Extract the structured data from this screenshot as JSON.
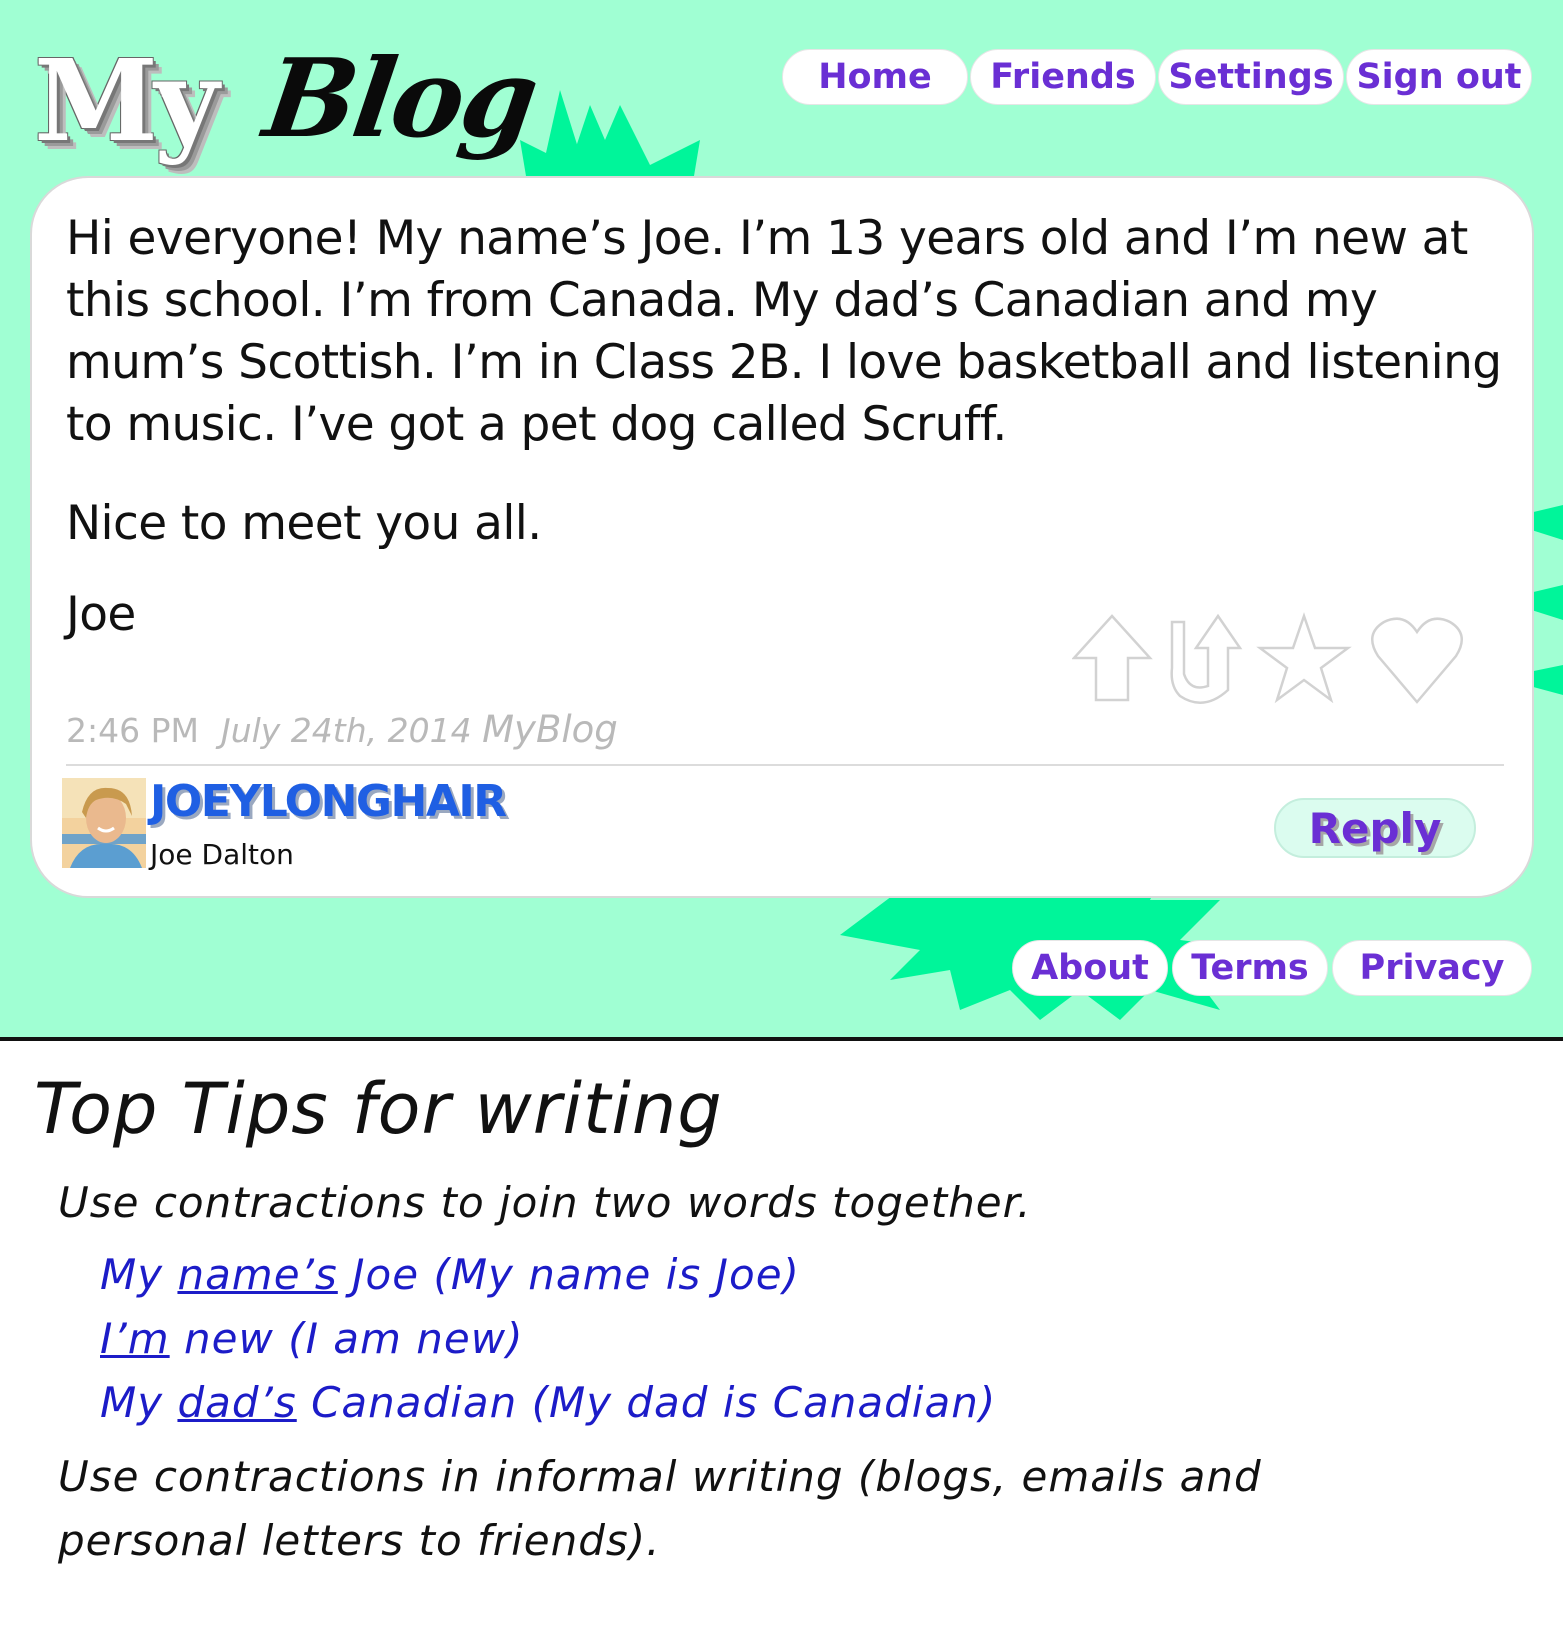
{
  "logo": {
    "part1": "My",
    "part2": "Blog"
  },
  "nav": {
    "home": "Home",
    "friends": "Friends",
    "settings": "Settings",
    "sign_out": "Sign out"
  },
  "post": {
    "body": "Hi everyone! My name’s Joe. I’m 13 years old and I’m new at this school. I’m from Canada. My dad’s Canadian and my mum’s Scottish. I’m in Class 2B. I love basketball and listening to music. I’ve got a pet dog called Scruff.",
    "closing": "Nice to meet you all.",
    "signature": "Joe",
    "time": "2:46 PM",
    "date": "July 24th, 2014",
    "site": "MyBlog",
    "author_username": "JOEYLONGHAIR",
    "author_name": "Joe Dalton",
    "reply_label": "Reply",
    "reaction_icons": [
      "up-arrow-icon",
      "u-turn-arrow-icon",
      "star-icon",
      "heart-icon"
    ]
  },
  "footer_nav": {
    "about": "About",
    "terms": "Terms",
    "privacy": "Privacy"
  },
  "tips": {
    "title": "Top Tips for writing",
    "line1": "Use contractions to join two words together.",
    "examples": [
      {
        "pre": "My ",
        "contraction": "name’s",
        "post": " Joe",
        "expanded": " (My name is Joe)"
      },
      {
        "pre": "",
        "contraction": "I’m",
        "post": " new",
        "expanded": " (I am new)"
      },
      {
        "pre": "My ",
        "contraction": "dad’s",
        "post": " Canadian",
        "expanded": " (My dad is Canadian)"
      }
    ],
    "line2a": "Use contractions in informal writing (blogs, emails and",
    "line2b": "personal letters to friends)."
  },
  "colors": {
    "background": "#a0ffd3",
    "burst": "#00f59a",
    "nav_text": "#6a2fd4",
    "username": "#1f5fe3",
    "example_text": "#1c1cc8"
  }
}
